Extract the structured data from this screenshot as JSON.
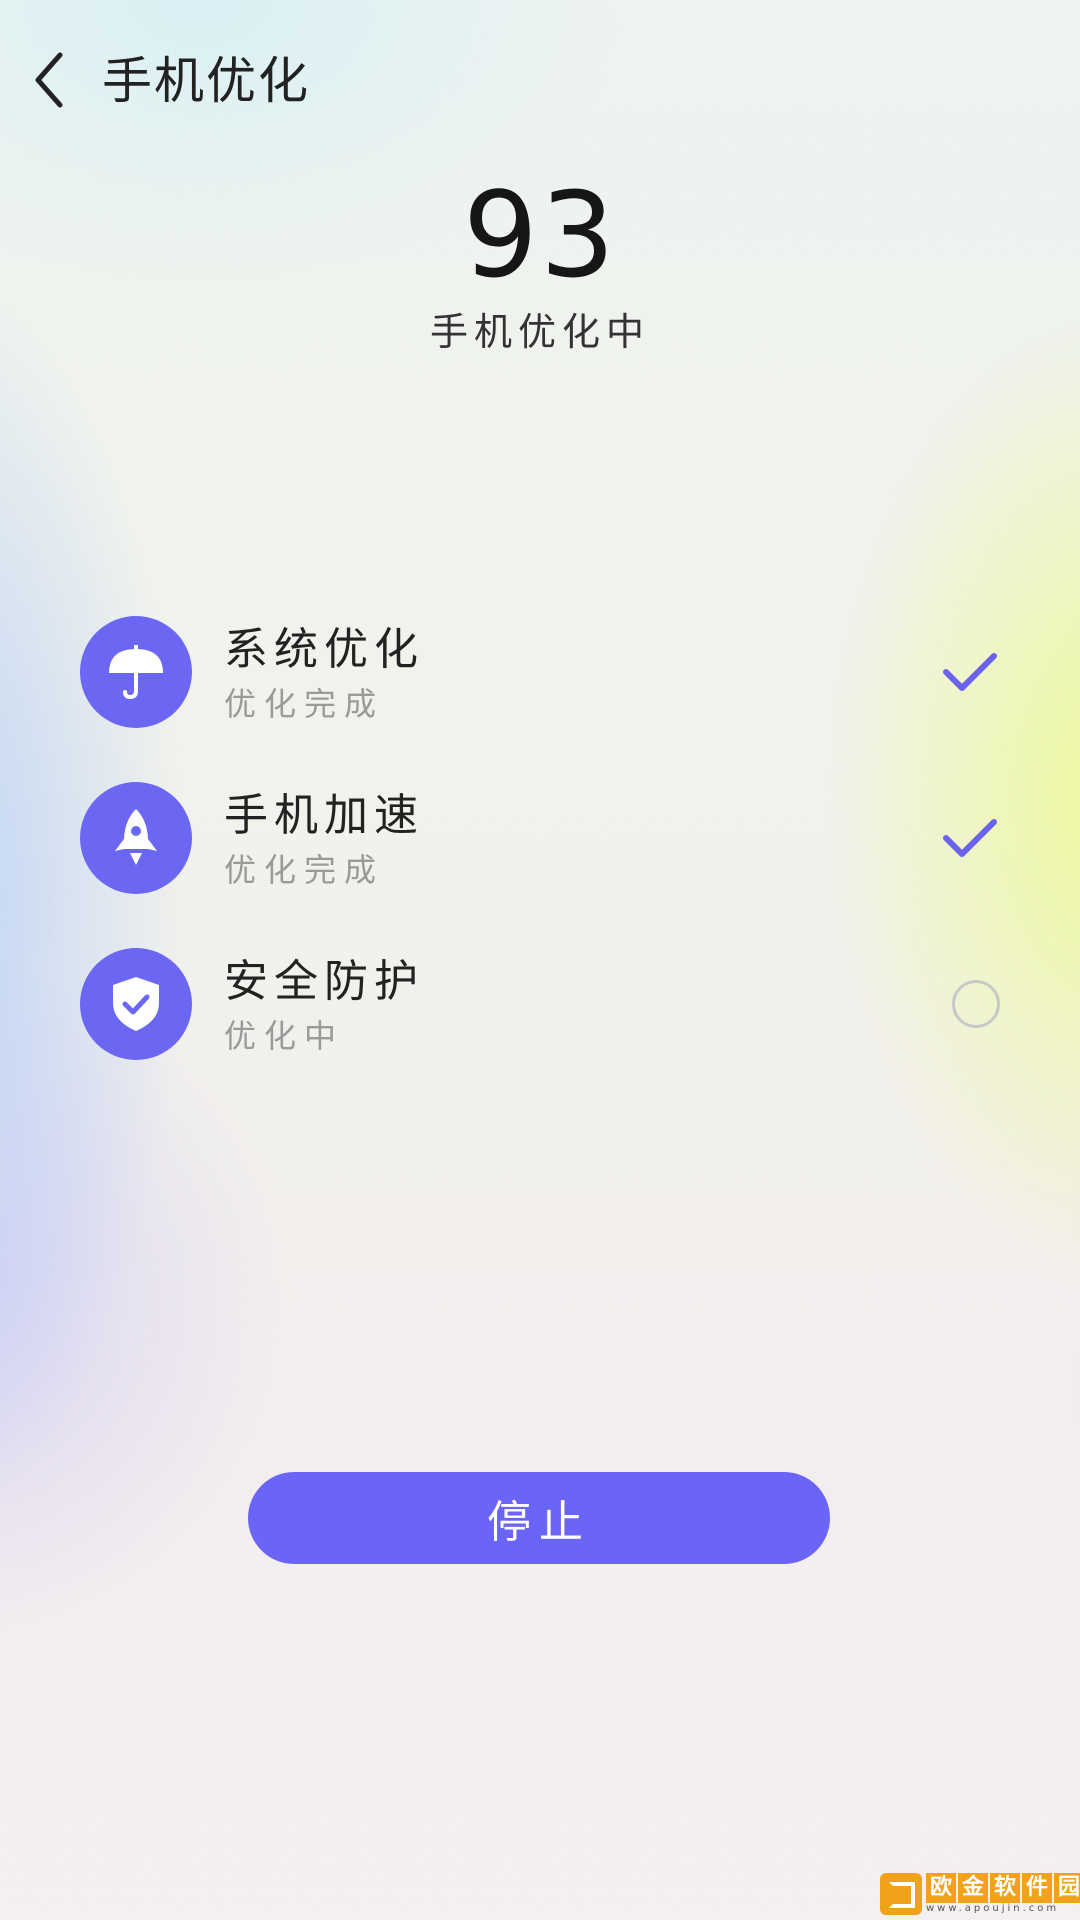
{
  "header": {
    "back_icon": "chevron-left-icon",
    "title": "手机优化"
  },
  "score": {
    "value": "93",
    "status": "手机优化中"
  },
  "items": [
    {
      "icon": "umbrella-icon",
      "title": "系统优化",
      "subtitle": "优化完成",
      "state": "done"
    },
    {
      "icon": "rocket-icon",
      "title": "手机加速",
      "subtitle": "优化完成",
      "state": "done"
    },
    {
      "icon": "shield-check-icon",
      "title": "安全防护",
      "subtitle": "优化中",
      "state": "in-progress"
    }
  ],
  "actions": {
    "stop_label": "停止"
  },
  "watermark": {
    "chars": [
      "欧",
      "金",
      "软",
      "件",
      "园"
    ],
    "url": "www.apoujin.com"
  },
  "colors": {
    "accent": "#6b67f3",
    "check": "#6b62ee"
  }
}
